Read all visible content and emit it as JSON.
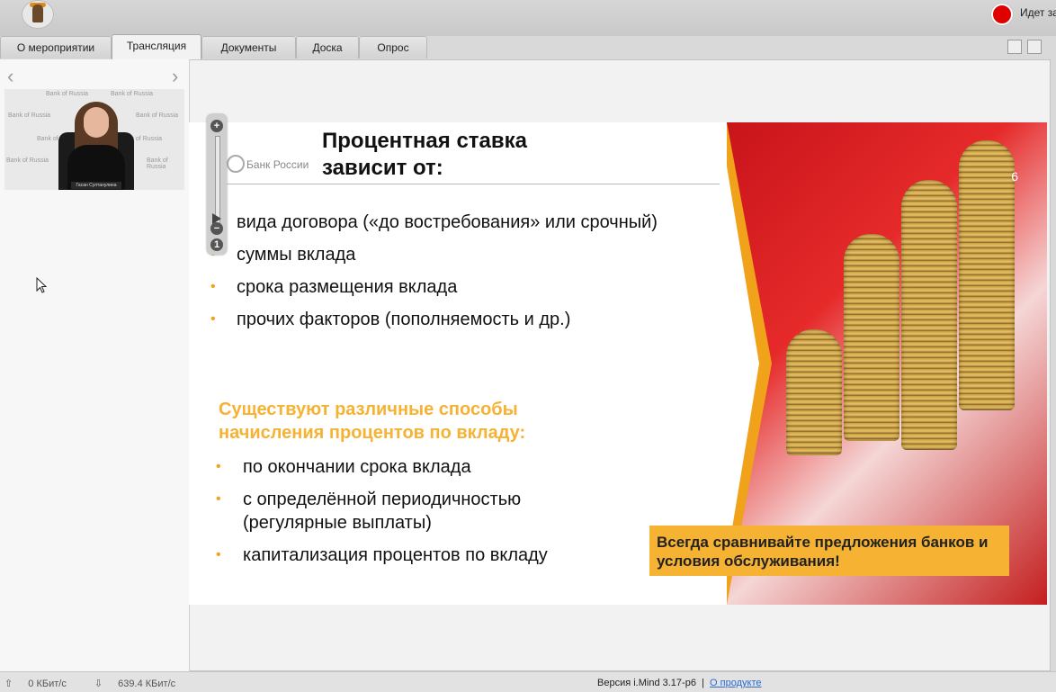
{
  "header": {
    "recording_label": "Идет за"
  },
  "tabs": [
    {
      "label": "О мероприятии"
    },
    {
      "label": "Трансляция"
    },
    {
      "label": "Документы"
    },
    {
      "label": "Доска"
    },
    {
      "label": "Опрос"
    }
  ],
  "sidebar": {
    "prev_icon": "chevron-left-icon",
    "next_icon": "chevron-right-icon",
    "video": {
      "watermark": "Bank of Russia",
      "name_plate": "Гасан Султанулина"
    }
  },
  "zoom": {
    "plus": "+",
    "minus": "−",
    "reset": "1"
  },
  "slide": {
    "logo_text": "Банк России",
    "title_line1": "Процентная ставка",
    "title_line2": "зависит от:",
    "bullets": [
      {
        "text": "вида договора («до востребования» или срочный)"
      },
      {
        "text": "суммы вклада"
      },
      {
        "text": "срока размещения вклада"
      },
      {
        "text": "прочих факторов (пополняемость и др.)"
      }
    ],
    "subheading": "Существуют различные способы начисления процентов по вкладу:",
    "bullets2": [
      {
        "text": "по окончании срока вклада"
      },
      {
        "text": "с определённой периодичностью (регулярные выплаты)"
      },
      {
        "text": "капитализация процентов по вкладу"
      }
    ],
    "slide_number": "6",
    "callout": "Всегда сравнивайте предложения банков и условия обслуживания!"
  },
  "status": {
    "upload": "0 КБит/с",
    "download": "639.4 КБит/с",
    "version": "Версия i.Mind 3.17-p6",
    "separator": "|",
    "about_link": "О продукте"
  },
  "colors": {
    "accent_orange": "#f5b233",
    "record_red": "#e10000"
  }
}
